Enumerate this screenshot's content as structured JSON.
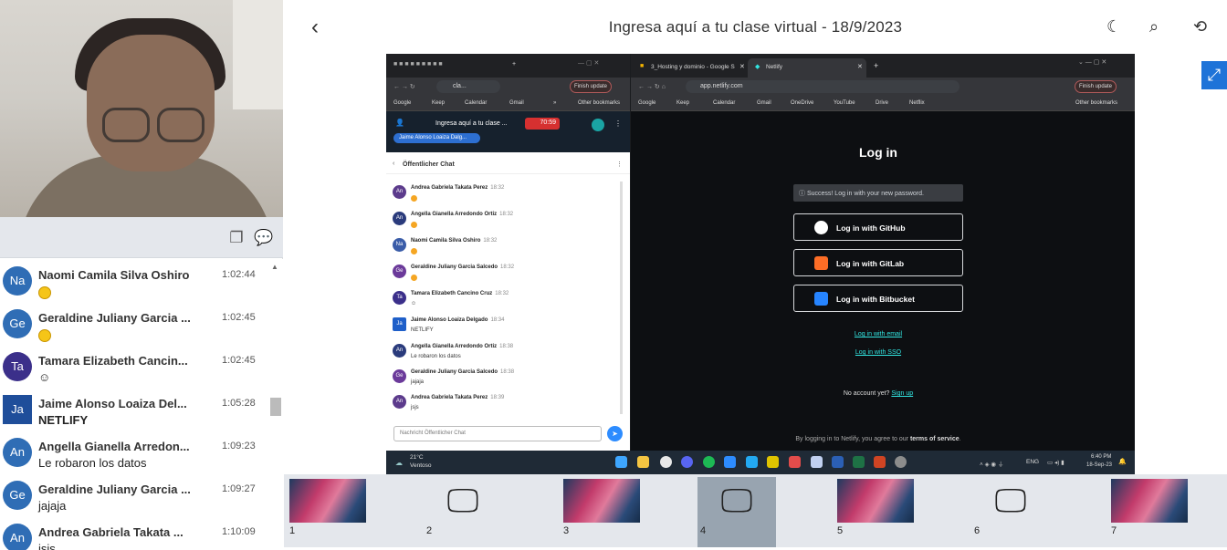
{
  "header": {
    "title": "Ingresa aquí a tu clase virtual - 18/9/2023"
  },
  "chat": {
    "messages": [
      {
        "initials": "Na",
        "name": "Naomi Camila Silva Oshiro",
        "time": "1:02:44",
        "text": "",
        "emoji": true,
        "color": "#2f6db5"
      },
      {
        "initials": "Ge",
        "name": "Geraldine Juliany Garcia ...",
        "time": "1:02:45",
        "text": "",
        "emoji": true,
        "color": "#2f6db5"
      },
      {
        "initials": "Ta",
        "name": "Tamara Elizabeth Cancin...",
        "time": "1:02:45",
        "text": "☺",
        "emoji": false,
        "color": "#3b2f8a"
      },
      {
        "initials": "Ja",
        "name": "Jaime Alonso Loaiza Del...",
        "time": "1:05:28",
        "text": "NETLIFY",
        "emoji": false,
        "color": "#1f4e9a"
      },
      {
        "initials": "An",
        "name": "Angella Gianella Arredon...",
        "time": "1:09:23",
        "text": "Le robaron los datos",
        "emoji": false,
        "color": "#2f6db5"
      },
      {
        "initials": "Ge",
        "name": "Geraldine Juliany Garcia ...",
        "time": "1:09:27",
        "text": "jajaja",
        "emoji": false,
        "color": "#2f6db5"
      },
      {
        "initials": "An",
        "name": "Andrea Gabriela Takata ...",
        "time": "1:10:09",
        "text": "jsjs",
        "emoji": false,
        "color": "#2f6db5"
      }
    ]
  },
  "shared_screen": {
    "left_window": {
      "tab_label": "cla...",
      "finish_update": "Finish update",
      "bookmarks": [
        "Google",
        "Keep",
        "Calendar",
        "Gmail",
        "»",
        "Other bookmarks"
      ],
      "meeting_title": "Ingresa aquí a tu clase ...",
      "recording": "70:59",
      "presenter": "Jaime Alonso Loaiza Dalg...",
      "chat_header": "Öffentlicher Chat",
      "input_placeholder": "Nachricht Öffentlicher Chat",
      "messages": [
        {
          "initials": "An",
          "name": "Andrea Gabriela Takata Perez",
          "time": "18:32",
          "text": "",
          "emoji": true,
          "color": "#5c3b8c"
        },
        {
          "initials": "An",
          "name": "Angella Gianella Arredondo Ortiz",
          "time": "18:32",
          "text": "",
          "emoji": true,
          "color": "#2a3b7c"
        },
        {
          "initials": "Na",
          "name": "Naomi Camila Silva Oshiro",
          "time": "18:32",
          "text": "",
          "emoji": true,
          "color": "#3a5ca8"
        },
        {
          "initials": "Ge",
          "name": "Geraldine Juliany Garcia Salcedo",
          "time": "18:32",
          "text": "",
          "emoji": true,
          "color": "#6b3a9a"
        },
        {
          "initials": "Ta",
          "name": "Tamara Elizabeth Cancino Cruz",
          "time": "18:32",
          "text": "☺",
          "emoji": false,
          "color": "#3b2f8a"
        },
        {
          "initials": "Ja",
          "name": "Jaime Alonso Loaiza Delgado",
          "time": "18:34",
          "text": "NETLIFY",
          "emoji": false,
          "color": "#1f5fc9"
        },
        {
          "initials": "An",
          "name": "Angella Gianella Arredondo Ortiz",
          "time": "18:38",
          "text": "Le robaron los datos",
          "emoji": false,
          "color": "#2a3b7c"
        },
        {
          "initials": "Ge",
          "name": "Geraldine Juliany Garcia Salcedo",
          "time": "18:38",
          "text": "jajaja",
          "emoji": false,
          "color": "#6b3a9a"
        },
        {
          "initials": "An",
          "name": "Andrea Gabriela Takata Perez",
          "time": "18:39",
          "text": "jsjs",
          "emoji": false,
          "color": "#5c3b8c"
        }
      ]
    },
    "right_window": {
      "tab1": "3_Hosting y dominio - Google S",
      "tab2": "Netlify",
      "url": "app.netlify.com",
      "finish_update": "Finish update",
      "bookmarks": [
        "Google",
        "Keep",
        "Calendar",
        "Gmail",
        "OneDrive",
        "YouTube",
        "Drive",
        "Netflix",
        "Other bookmarks"
      ],
      "login_title": "Log in",
      "success_msg": "Success! Log in with your new password.",
      "btn_github": "Log in with GitHub",
      "btn_gitlab": "Log in with GitLab",
      "btn_bitbucket": "Log in with Bitbucket",
      "link_email": "Log in with email",
      "link_sso": "Log in with SSO",
      "no_account": "No account yet?",
      "signup": "Sign up",
      "terms_prefix": "By logging in to Netlify, you agree to our",
      "terms_link": "terms of service",
      "terms_suffix": "."
    },
    "taskbar": {
      "weather_temp": "21°C",
      "weather_desc": "Ventoso",
      "lang": "ENG",
      "time": "6:40 PM",
      "date": "18-Sep-23"
    }
  },
  "thumbnails": [
    {
      "num": "1",
      "type": "image",
      "selected": false
    },
    {
      "num": "2",
      "type": "monitor",
      "selected": false
    },
    {
      "num": "3",
      "type": "image",
      "selected": false
    },
    {
      "num": "4",
      "type": "monitor",
      "selected": true
    },
    {
      "num": "5",
      "type": "image",
      "selected": false
    },
    {
      "num": "6",
      "type": "monitor",
      "selected": false
    },
    {
      "num": "7",
      "type": "image",
      "selected": false
    }
  ]
}
